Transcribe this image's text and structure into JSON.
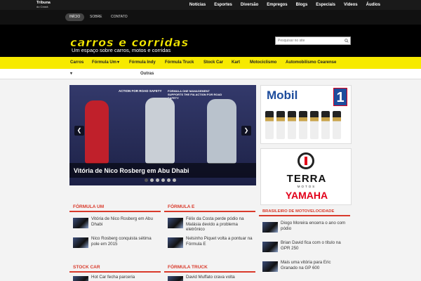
{
  "topbar": {
    "logo_main": "Tribuna",
    "logo_sub": "do Ceará",
    "nav": [
      "Notícias",
      "Esportes",
      "Diversão",
      "Empregos",
      "Blogs",
      "Especiais",
      "Vídeos",
      "Áudios"
    ]
  },
  "subnav": {
    "items": [
      "INÍCIO",
      "SOBRE",
      "CONTATO"
    ]
  },
  "header": {
    "title": "carros e corridas",
    "tagline": "Um espaço sobre carros, motos e corridas",
    "search_placeholder": "Pesquisar no site"
  },
  "mainnav": {
    "items": [
      "Carros",
      "Fórmula Um",
      "Fórmula Indy",
      "Fórmula Truck",
      "Stock Car",
      "Kart",
      "Motociclismo",
      "Automobilismo Cearense"
    ],
    "more": "Outras"
  },
  "slider": {
    "caption": "Vitória de Nico Rosberg em Abu Dhabi",
    "banner1": "ACTION FOR ROAD SAFETY",
    "banner2": "FORMULA ONE MANAGEMENT SUPPORTS THE FIA ACTION FOR ROAD SAFETY",
    "dots": 6,
    "active_dot": 0
  },
  "ads": {
    "mobil_brand": "Mobil",
    "mobil_number": "1",
    "terra": "TERRA",
    "terra_sub": "MOTOS",
    "yamaha": "YAMAHA"
  },
  "sections": {
    "formula_um": {
      "title": "FÓRMULA UM",
      "items": [
        "Vitória de Nico Rosberg em Abu Dhabi",
        "Nico Rosberg conquista sétima pole em 2015"
      ]
    },
    "formula_e": {
      "title": "FÓRMULA E",
      "items": [
        "Félix da Costa perde pódio na Malásia devido a problema eletrônico",
        "Nelsinho Piquet volta a pontuar na Fórmula E"
      ]
    },
    "motovelocidade": {
      "title": "BRASILEIRO DE MOTOVELOCIDADE",
      "items": [
        "Diogo Moreira encerra o ano com pódio",
        "Brian David fica com o título na GPR 250",
        "Mais uma vitória para Eric Granado na GP 600"
      ]
    },
    "stock_car": {
      "title": "STOCK CAR",
      "items": [
        "Hot Car fecha parceria"
      ]
    },
    "formula_truck": {
      "title": "FÓRMULA TRUCK",
      "items": [
        "David Muffato crava volta"
      ]
    }
  }
}
